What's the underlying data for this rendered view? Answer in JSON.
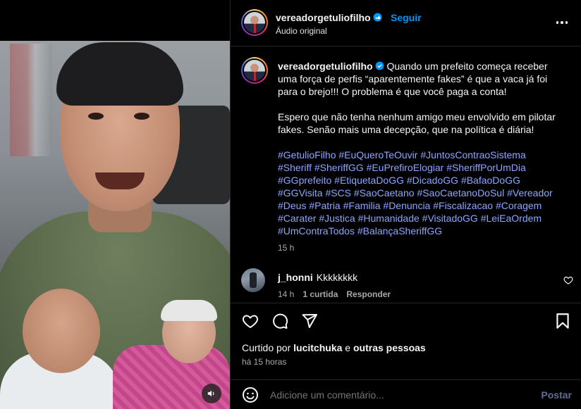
{
  "header": {
    "username": "vereadorgetuliofilho",
    "separator": "•",
    "follow_label": "Seguir",
    "audio_label": "Áudio original"
  },
  "caption": {
    "username": "vereadorgetuliofilho",
    "paragraph1": "Quando um prefeito começa receber uma força de perfis “aparentemente fakes” é que a vaca já foi para o brejo!!! O problema é que você paga a conta!",
    "paragraph2": "Espero que não tenha nenhum amigo meu envolvido em pilotar fakes. Senão mais uma decepção, que na política é diária!",
    "hashtags": [
      "#GetulioFilho",
      "#EuQueroTeOuvir",
      "#JuntosContraoSistema",
      "#Sheriff",
      "#SheriffGG",
      "#EuPrefiroElogiar",
      "#SheriffPorUmDia",
      "#GGprefeito",
      "#EtiquetaDoGG",
      "#DicadoGG",
      "#BafaoDoGG",
      "#GGVisita",
      "#SCS",
      "#SaoCaetano",
      "#SaoCaetanoDoSul",
      "#Vereador",
      "#Deus",
      "#Patria",
      "#Familia",
      "#Denuncia",
      "#Fiscalizacao",
      "#Coragem",
      "#Carater",
      "#Justica",
      "#Humanidade",
      "#VisitadoGG",
      "#LeiEaOrdem",
      "#UmContraTodos",
      "#BalançaSheriffGG"
    ],
    "time": "15 h"
  },
  "comment": {
    "username": "j_honni",
    "text": "Kkkkkkkk",
    "time": "14 h",
    "likes": "1 curtida",
    "reply_label": "Responder"
  },
  "likes": {
    "prefix": "Curtido por",
    "user": "lucitchuka",
    "conj": "e",
    "others": "outras pessoas",
    "ago": "há 15 horas"
  },
  "add_comment": {
    "placeholder": "Adicione um comentário...",
    "post_label": "Postar"
  },
  "icons": {
    "verified": "verified-badge-icon",
    "more": "more-options-icon",
    "like": "heart-icon",
    "comment": "comment-bubble-icon",
    "share": "paper-plane-icon",
    "save": "bookmark-icon",
    "emoji": "emoji-smile-icon",
    "mute": "speaker-icon"
  },
  "colors": {
    "link": "#0095f6",
    "hashtag": "#8ea5ff",
    "muted": "#a8a8a8",
    "background": "#000000"
  }
}
